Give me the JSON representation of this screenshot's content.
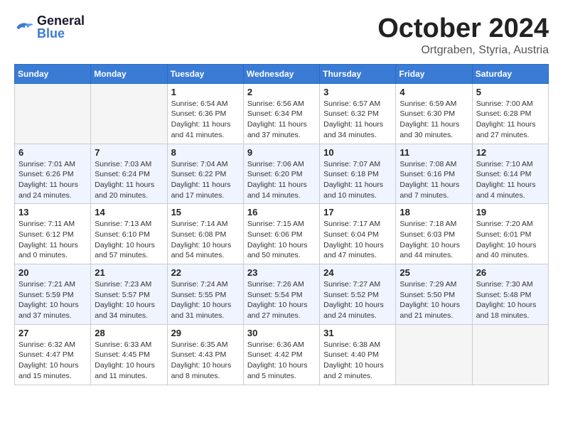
{
  "logo": {
    "line1": "General",
    "line2": "Blue"
  },
  "title": "October 2024",
  "subtitle": "Ortgraben, Styria, Austria",
  "days_of_week": [
    "Sunday",
    "Monday",
    "Tuesday",
    "Wednesday",
    "Thursday",
    "Friday",
    "Saturday"
  ],
  "weeks": [
    [
      {
        "day": "",
        "info": ""
      },
      {
        "day": "",
        "info": ""
      },
      {
        "day": "1",
        "info": "Sunrise: 6:54 AM\nSunset: 6:36 PM\nDaylight: 11 hours and 41 minutes."
      },
      {
        "day": "2",
        "info": "Sunrise: 6:56 AM\nSunset: 6:34 PM\nDaylight: 11 hours and 37 minutes."
      },
      {
        "day": "3",
        "info": "Sunrise: 6:57 AM\nSunset: 6:32 PM\nDaylight: 11 hours and 34 minutes."
      },
      {
        "day": "4",
        "info": "Sunrise: 6:59 AM\nSunset: 6:30 PM\nDaylight: 11 hours and 30 minutes."
      },
      {
        "day": "5",
        "info": "Sunrise: 7:00 AM\nSunset: 6:28 PM\nDaylight: 11 hours and 27 minutes."
      }
    ],
    [
      {
        "day": "6",
        "info": "Sunrise: 7:01 AM\nSunset: 6:26 PM\nDaylight: 11 hours and 24 minutes."
      },
      {
        "day": "7",
        "info": "Sunrise: 7:03 AM\nSunset: 6:24 PM\nDaylight: 11 hours and 20 minutes."
      },
      {
        "day": "8",
        "info": "Sunrise: 7:04 AM\nSunset: 6:22 PM\nDaylight: 11 hours and 17 minutes."
      },
      {
        "day": "9",
        "info": "Sunrise: 7:06 AM\nSunset: 6:20 PM\nDaylight: 11 hours and 14 minutes."
      },
      {
        "day": "10",
        "info": "Sunrise: 7:07 AM\nSunset: 6:18 PM\nDaylight: 11 hours and 10 minutes."
      },
      {
        "day": "11",
        "info": "Sunrise: 7:08 AM\nSunset: 6:16 PM\nDaylight: 11 hours and 7 minutes."
      },
      {
        "day": "12",
        "info": "Sunrise: 7:10 AM\nSunset: 6:14 PM\nDaylight: 11 hours and 4 minutes."
      }
    ],
    [
      {
        "day": "13",
        "info": "Sunrise: 7:11 AM\nSunset: 6:12 PM\nDaylight: 11 hours and 0 minutes."
      },
      {
        "day": "14",
        "info": "Sunrise: 7:13 AM\nSunset: 6:10 PM\nDaylight: 10 hours and 57 minutes."
      },
      {
        "day": "15",
        "info": "Sunrise: 7:14 AM\nSunset: 6:08 PM\nDaylight: 10 hours and 54 minutes."
      },
      {
        "day": "16",
        "info": "Sunrise: 7:15 AM\nSunset: 6:06 PM\nDaylight: 10 hours and 50 minutes."
      },
      {
        "day": "17",
        "info": "Sunrise: 7:17 AM\nSunset: 6:04 PM\nDaylight: 10 hours and 47 minutes."
      },
      {
        "day": "18",
        "info": "Sunrise: 7:18 AM\nSunset: 6:03 PM\nDaylight: 10 hours and 44 minutes."
      },
      {
        "day": "19",
        "info": "Sunrise: 7:20 AM\nSunset: 6:01 PM\nDaylight: 10 hours and 40 minutes."
      }
    ],
    [
      {
        "day": "20",
        "info": "Sunrise: 7:21 AM\nSunset: 5:59 PM\nDaylight: 10 hours and 37 minutes."
      },
      {
        "day": "21",
        "info": "Sunrise: 7:23 AM\nSunset: 5:57 PM\nDaylight: 10 hours and 34 minutes."
      },
      {
        "day": "22",
        "info": "Sunrise: 7:24 AM\nSunset: 5:55 PM\nDaylight: 10 hours and 31 minutes."
      },
      {
        "day": "23",
        "info": "Sunrise: 7:26 AM\nSunset: 5:54 PM\nDaylight: 10 hours and 27 minutes."
      },
      {
        "day": "24",
        "info": "Sunrise: 7:27 AM\nSunset: 5:52 PM\nDaylight: 10 hours and 24 minutes."
      },
      {
        "day": "25",
        "info": "Sunrise: 7:29 AM\nSunset: 5:50 PM\nDaylight: 10 hours and 21 minutes."
      },
      {
        "day": "26",
        "info": "Sunrise: 7:30 AM\nSunset: 5:48 PM\nDaylight: 10 hours and 18 minutes."
      }
    ],
    [
      {
        "day": "27",
        "info": "Sunrise: 6:32 AM\nSunset: 4:47 PM\nDaylight: 10 hours and 15 minutes."
      },
      {
        "day": "28",
        "info": "Sunrise: 6:33 AM\nSunset: 4:45 PM\nDaylight: 10 hours and 11 minutes."
      },
      {
        "day": "29",
        "info": "Sunrise: 6:35 AM\nSunset: 4:43 PM\nDaylight: 10 hours and 8 minutes."
      },
      {
        "day": "30",
        "info": "Sunrise: 6:36 AM\nSunset: 4:42 PM\nDaylight: 10 hours and 5 minutes."
      },
      {
        "day": "31",
        "info": "Sunrise: 6:38 AM\nSunset: 4:40 PM\nDaylight: 10 hours and 2 minutes."
      },
      {
        "day": "",
        "info": ""
      },
      {
        "day": "",
        "info": ""
      }
    ]
  ]
}
